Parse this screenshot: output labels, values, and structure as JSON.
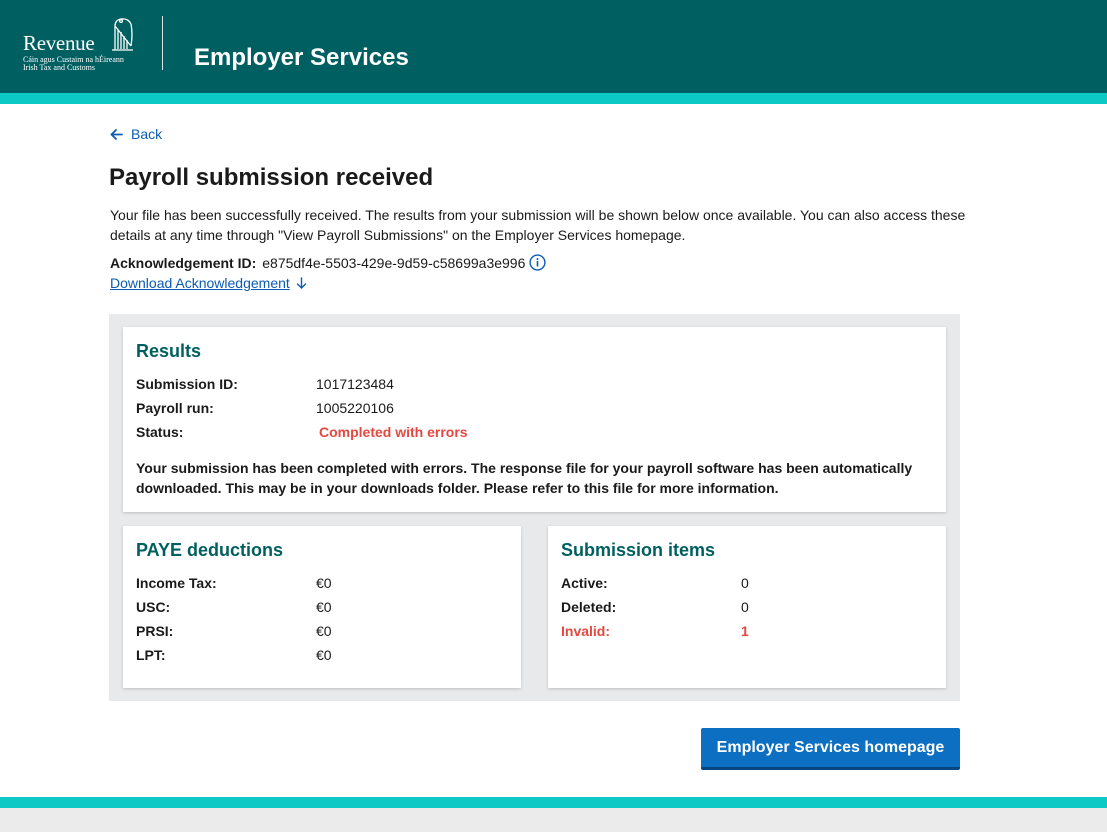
{
  "header": {
    "logo": {
      "wordmark": "Revenue",
      "line1": "Cáin agus Custaim na hÉireann",
      "line2": "Irish Tax and Customs"
    },
    "title": "Employer Services",
    "background_color": "#005f61",
    "stripe_color": "#0dc9c6"
  },
  "nav": {
    "back_label": "Back"
  },
  "main": {
    "title": "Payroll submission received",
    "intro": "Your file has been successfully received. The results from your submission will be shown below once available. You can also access these details at any time through \"View Payroll Submissions\" on the Employer Services homepage.",
    "acknowledgement_label": "Acknowledgement ID:",
    "acknowledgement_id": "e875df4e-5503-429e-9d59-c58699a3e996",
    "download_label": "Download Acknowledgement"
  },
  "results": {
    "heading": "Results",
    "rows": [
      {
        "label": "Submission ID:",
        "value": "1017123484"
      },
      {
        "label": "Payroll run:",
        "value": "1005220106"
      },
      {
        "label": "Status:",
        "value": "Completed with errors"
      }
    ],
    "note": "Your submission has been completed with errors. The response file for your payroll software has been automatically downloaded. This may be in your downloads folder. Please refer to this file for more information.",
    "status_color": "#e5483f"
  },
  "paye": {
    "heading": "PAYE deductions",
    "rows": [
      {
        "label": "Income Tax:",
        "value": "€0"
      },
      {
        "label": "USC:",
        "value": "€0"
      },
      {
        "label": "PRSI:",
        "value": "€0"
      },
      {
        "label": "LPT:",
        "value": "€0"
      }
    ]
  },
  "items": {
    "heading": "Submission items",
    "rows": [
      {
        "label": "Active:",
        "value": "0"
      },
      {
        "label": "Deleted:",
        "value": "0"
      },
      {
        "label": "Invalid:",
        "value": "1"
      }
    ]
  },
  "actions": {
    "homepage_button": "Employer Services homepage",
    "button_color": "#0d6fc2"
  },
  "icons": {
    "back": "arrow-left-icon",
    "info": "info-circle-icon",
    "download": "arrow-down-icon",
    "logo": "harp-icon"
  }
}
